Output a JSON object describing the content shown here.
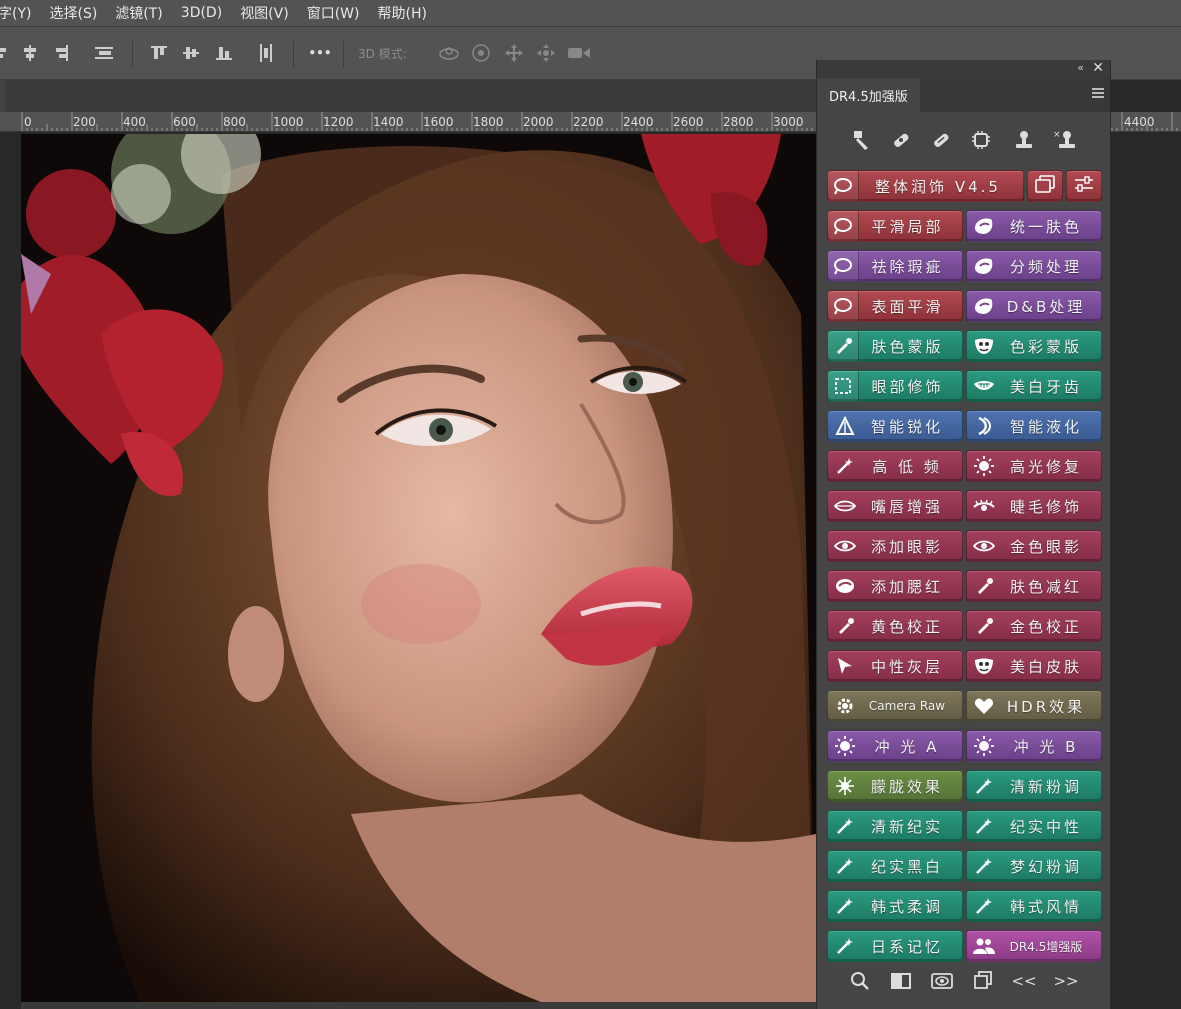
{
  "menubar": {
    "items": [
      "字(Y)",
      "选择(S)",
      "滤镜(T)",
      "3D(D)",
      "视图(V)",
      "窗口(W)",
      "帮助(H)"
    ]
  },
  "optionsbar": {
    "mode3d_label": "3D 模式:",
    "more_label": "•••"
  },
  "ruler": {
    "labels": [
      "0",
      "200",
      "400",
      "600",
      "800",
      "1000",
      "1200",
      "1400",
      "1600",
      "1800",
      "2000",
      "2200",
      "2400",
      "2600",
      "2800",
      "3000",
      "4400"
    ]
  },
  "panel": {
    "tab_title": "DR4.5加强版",
    "collapse": "«",
    "close": "✕",
    "main_button": "整体润饰  V4.5",
    "buttons": [
      {
        "left": "平滑局部",
        "right": "统一肤色"
      },
      {
        "left": "祛除瑕疵",
        "right": "分频处理"
      },
      {
        "left": "表面平滑",
        "right": "D&B处理"
      },
      {
        "left": "肤色蒙版",
        "right": "色彩蒙版"
      },
      {
        "left": "眼部修饰",
        "right": "美白牙齿"
      },
      {
        "left": "智能锐化",
        "right": "智能液化"
      },
      {
        "left": "高 低 频",
        "right": "高光修复"
      },
      {
        "left": "嘴唇增强",
        "right": "睫毛修饰"
      },
      {
        "left": "添加眼影",
        "right": "金色眼影"
      },
      {
        "left": "添加腮红",
        "right": "肤色减红"
      },
      {
        "left": "黄色校正",
        "right": "金色校正"
      },
      {
        "left": "中性灰层",
        "right": "美白皮肤"
      },
      {
        "left": "Camera Raw",
        "right": "HDR效果"
      },
      {
        "left": "冲 光 A",
        "right": "冲 光 B"
      },
      {
        "left": "朦胧效果",
        "right": "清新粉调"
      },
      {
        "left": "清新纪实",
        "right": "纪实中性"
      },
      {
        "left": "纪实黑白",
        "right": "梦幻粉调"
      },
      {
        "left": "韩式柔调",
        "right": "韩式风情"
      },
      {
        "left": "日系记忆",
        "right": "DR4.5增强版"
      }
    ],
    "bottom_prev": "<<",
    "bottom_next": ">>"
  },
  "colors": {
    "red": "#a03d45",
    "purple": "#7a4c99",
    "green": "#248a70",
    "blue": "#4566a0",
    "wine": "#952f50",
    "khaki": "#706a4e",
    "olive": "#60803e",
    "magenta": "#9e4696"
  }
}
